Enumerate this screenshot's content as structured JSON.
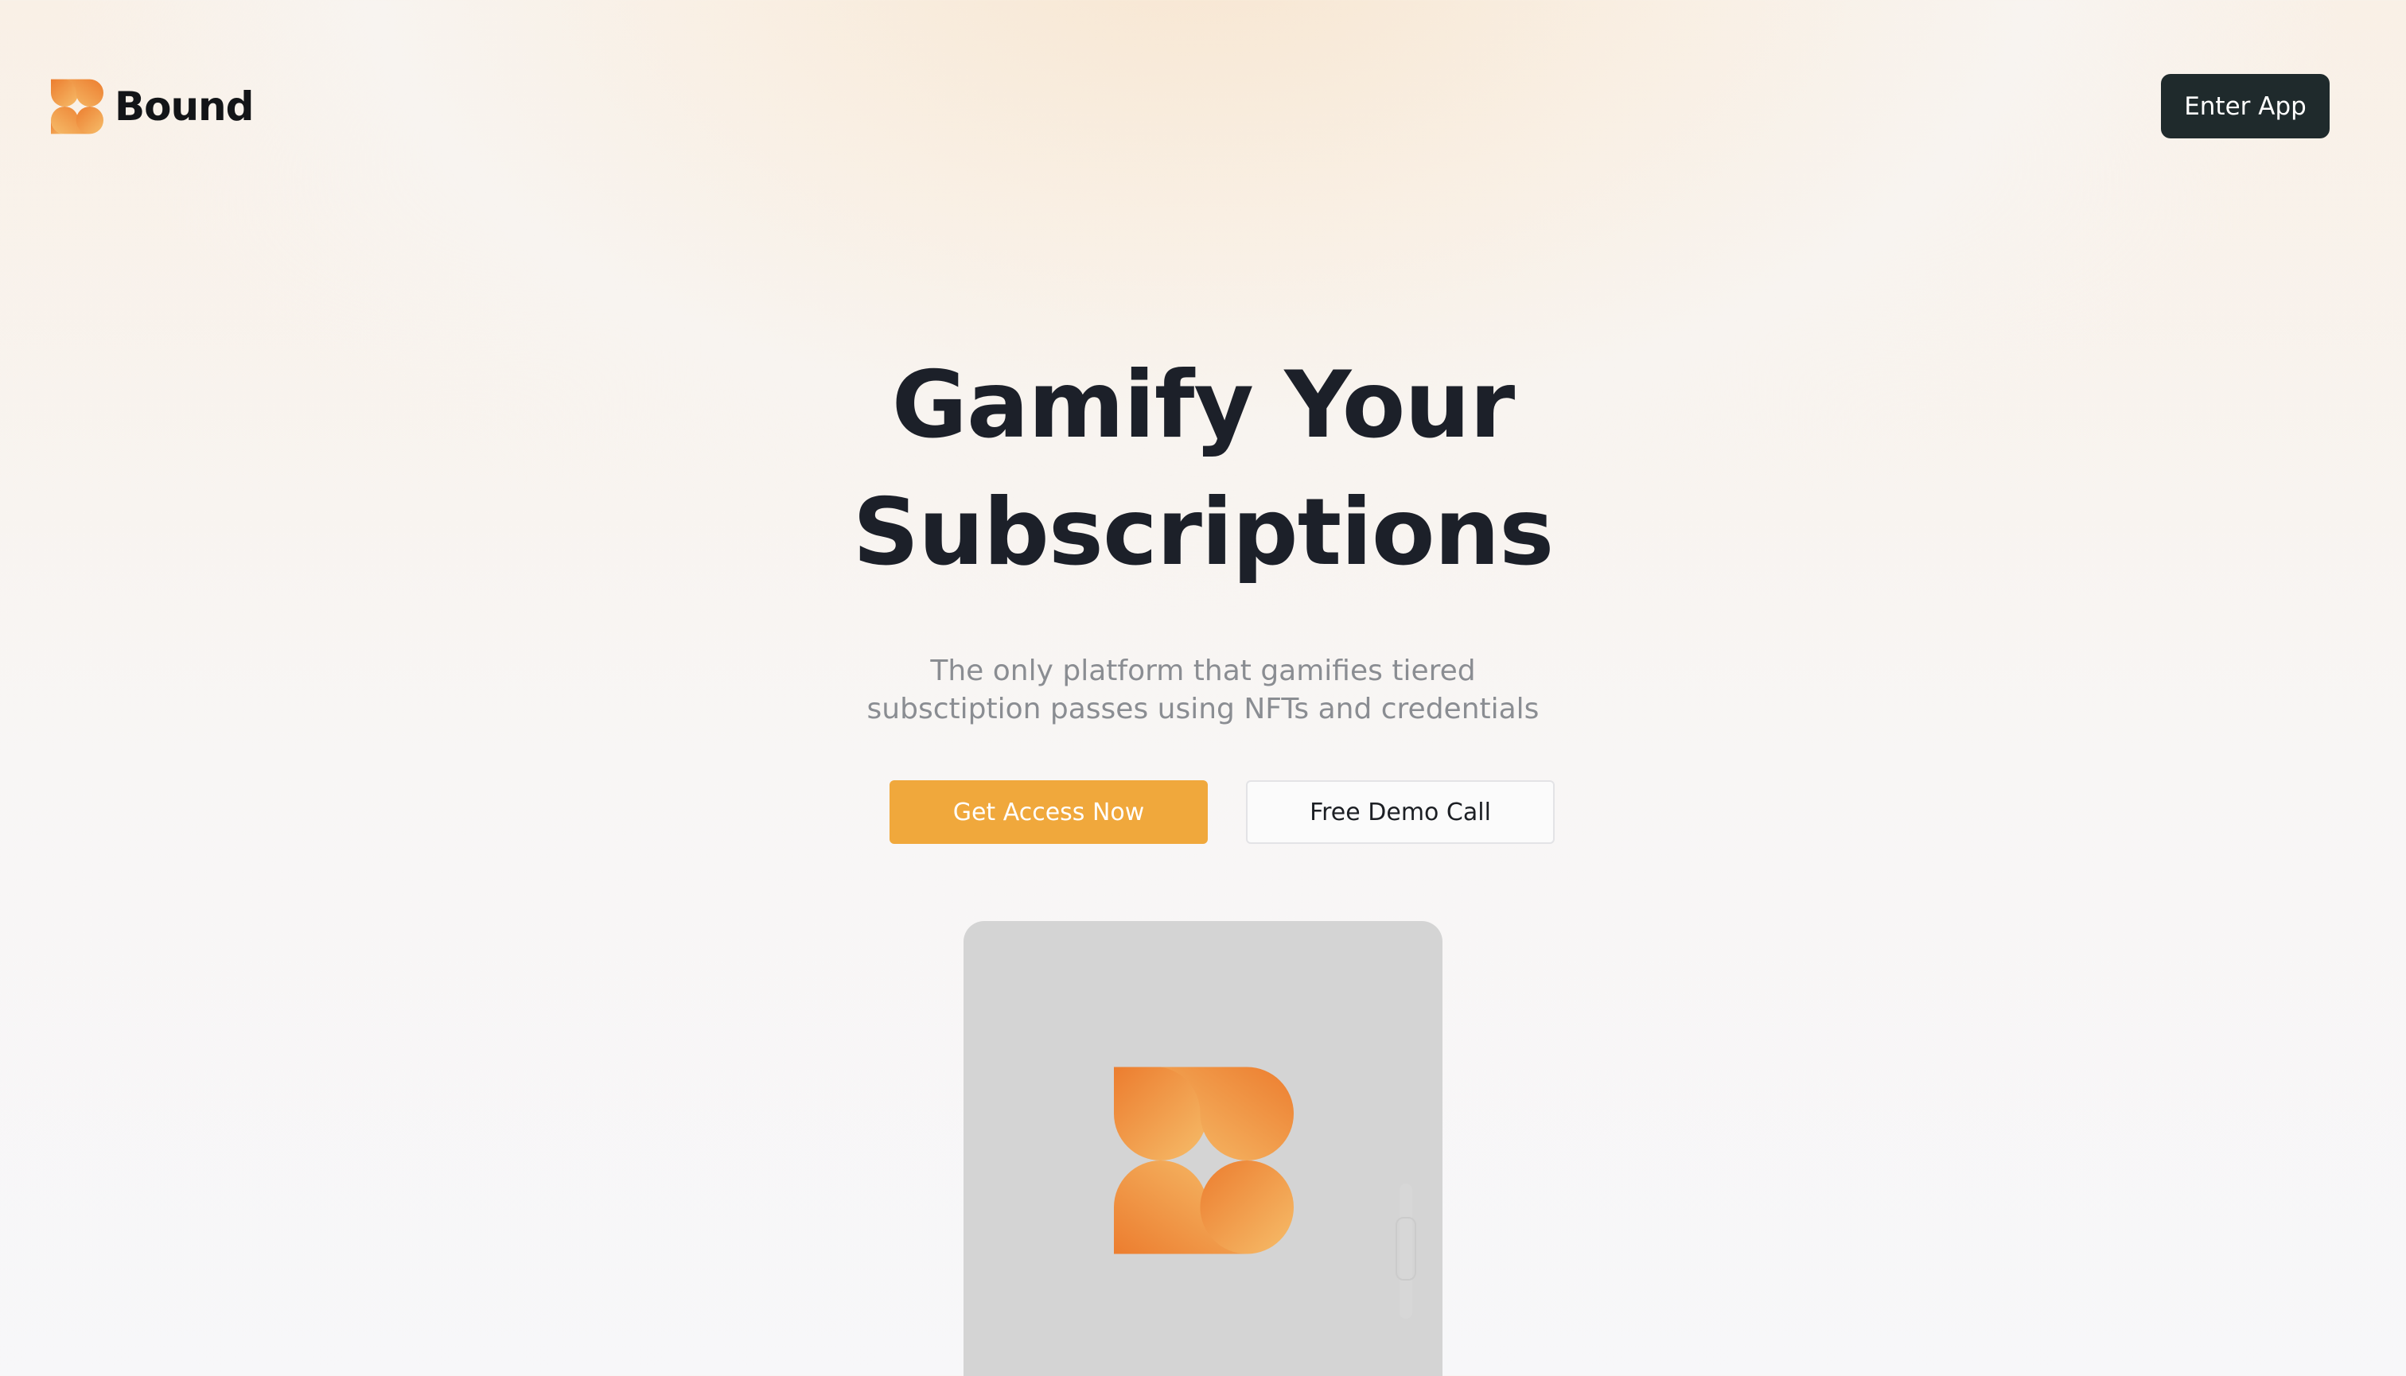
{
  "header": {
    "brand_name": "Bound",
    "enter_app_label": "Enter App"
  },
  "hero": {
    "title_line1": "Gamify Your",
    "title_line2": "Subscriptions",
    "subtitle_line1": "The only platform that gamifies tiered",
    "subtitle_line2": "subsctiption passes using NFTs and credentials",
    "primary_cta_label": "Get Access Now",
    "secondary_cta_label": "Free Demo Call"
  },
  "icons": {
    "brand_logo": "bound-logo-icon",
    "preview_logo": "bound-logo-icon"
  },
  "colors": {
    "accent": "#f0a83c",
    "dark_button": "#1f2a2c",
    "logo_orange_dark": "#ec7d2f",
    "logo_orange_light": "#f6bd6a",
    "heading": "#1c2029",
    "subtitle": "#8a8d92",
    "preview_card": "#d4d4d4"
  }
}
